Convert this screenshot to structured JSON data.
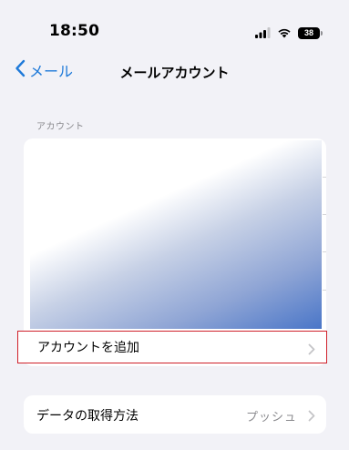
{
  "status_bar": {
    "time": "18:50",
    "battery_level": "38",
    "icons": [
      "cellular-signal-icon",
      "wifi-icon",
      "battery-icon"
    ]
  },
  "nav": {
    "back_label": "メール",
    "title": "メールアカウント"
  },
  "accounts_section": {
    "header": "アカウント"
  },
  "add_account": {
    "label": "アカウントを追加"
  },
  "fetch": {
    "label": "データの取得方法",
    "value": "プッシュ"
  },
  "colors": {
    "accent": "#1f7ad9",
    "highlight_border": "#d0202a",
    "background": "#f2f2f7",
    "secondary_text": "#8a8a8e"
  }
}
